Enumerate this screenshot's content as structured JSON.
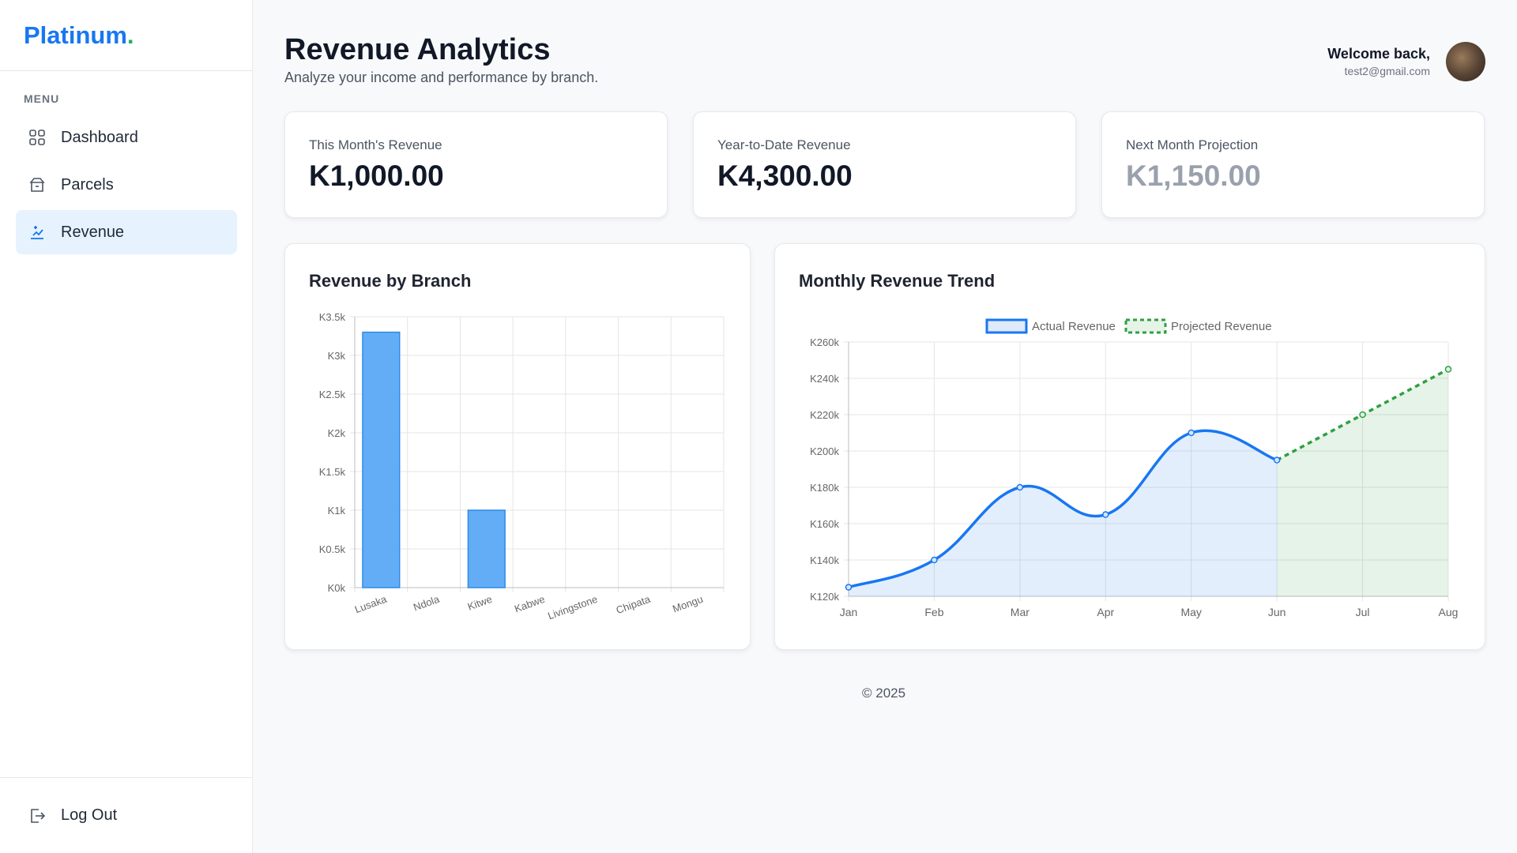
{
  "brand": {
    "name": "Platinum",
    "dot": "."
  },
  "sidebar": {
    "menu_heading": "MENU",
    "items": [
      {
        "label": "Dashboard",
        "icon": "grid-icon",
        "active": false
      },
      {
        "label": "Parcels",
        "icon": "parcel-icon",
        "active": false
      },
      {
        "label": "Revenue",
        "icon": "revenue-icon",
        "active": true
      }
    ],
    "logout_label": "Log Out"
  },
  "header": {
    "title": "Revenue Analytics",
    "subtitle": "Analyze your income and performance by branch."
  },
  "user": {
    "welcome": "Welcome back,",
    "email": "test2@gmail.com"
  },
  "stats": [
    {
      "label": "This Month's Revenue",
      "value": "K1,000.00"
    },
    {
      "label": "Year-to-Date Revenue",
      "value": "K4,300.00"
    },
    {
      "label": "Next Month Projection",
      "value": "K1,150.00"
    }
  ],
  "colors": {
    "accent": "#1877f2",
    "brand_dot": "#22b05c",
    "bar": "#63adf7",
    "line": "#1877f2",
    "projection": "#2ea043"
  },
  "footer": "© 2025",
  "chart_data": [
    {
      "type": "bar",
      "title": "Revenue by Branch",
      "categories": [
        "Lusaka",
        "Ndola",
        "Kitwe",
        "Kabwe",
        "Livingstone",
        "Chipata",
        "Mongu"
      ],
      "values": [
        3300,
        0,
        1000,
        0,
        0,
        0,
        0
      ],
      "ylim": [
        0,
        3500
      ],
      "y_ticks": [
        "K0k",
        "K0.5k",
        "K1k",
        "K1.5k",
        "K2k",
        "K2.5k",
        "K3k",
        "K3.5k"
      ],
      "grid": true
    },
    {
      "type": "line",
      "title": "Monthly Revenue Trend",
      "categories": [
        "Jan",
        "Feb",
        "Mar",
        "Apr",
        "May",
        "Jun",
        "Jul",
        "Aug"
      ],
      "series": [
        {
          "name": "Actual Revenue",
          "values": [
            125000,
            140000,
            180000,
            165000,
            210000,
            195000,
            null,
            null
          ]
        },
        {
          "name": "Projected Revenue",
          "values": [
            null,
            null,
            null,
            null,
            null,
            195000,
            220000,
            245000
          ]
        }
      ],
      "ylim": [
        120000,
        260000
      ],
      "y_ticks": [
        "K120k",
        "K140k",
        "K160k",
        "K180k",
        "K200k",
        "K220k",
        "K240k",
        "K260k"
      ],
      "legend": "top",
      "grid": true
    }
  ]
}
